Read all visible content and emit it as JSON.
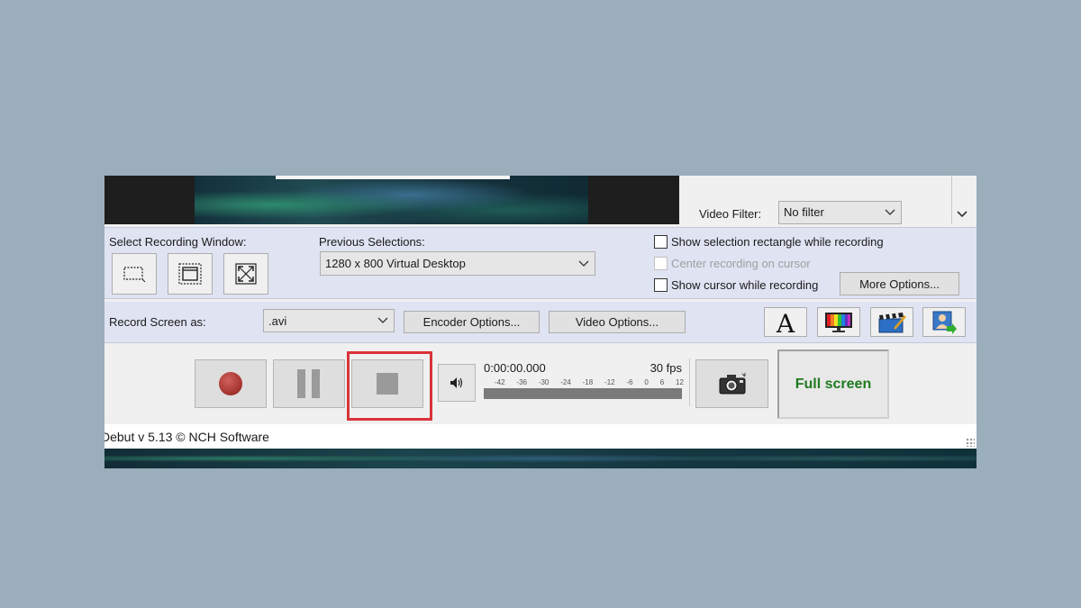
{
  "app": {
    "status_text": "Debut v 5.13 © NCH Software"
  },
  "preview": {
    "video_filter_label": "Video Filter:",
    "video_filter_value": "No filter"
  },
  "selection": {
    "select_window_label": "Select Recording Window:",
    "previous_selections_label": "Previous Selections:",
    "previous_selection_value": "1280 x 800 Virtual Desktop",
    "options": [
      {
        "label": "Show selection rectangle while recording",
        "checked": false,
        "enabled": true
      },
      {
        "label": "Center recording on cursor",
        "checked": false,
        "enabled": false
      },
      {
        "label": "Show cursor while recording",
        "checked": false,
        "enabled": true
      }
    ],
    "more_options_label": "More Options..."
  },
  "record_as": {
    "label": "Record Screen as:",
    "format_value": ".avi",
    "encoder_options_label": "Encoder Options...",
    "video_options_label": "Video Options..."
  },
  "controls": {
    "time": "0:00:00.000",
    "fps": "30 fps",
    "meter_ticks": [
      "-42",
      "-36",
      "-30",
      "-24",
      "-18",
      "-12",
      "-6",
      "0",
      "6",
      "12"
    ],
    "full_screen_label": "Full screen"
  },
  "colors": {
    "record_red": "#b33a3a",
    "highlight_red": "#d9333a",
    "full_screen_green": "#1f7a1f",
    "panel_bg": "#dfe3f2"
  }
}
